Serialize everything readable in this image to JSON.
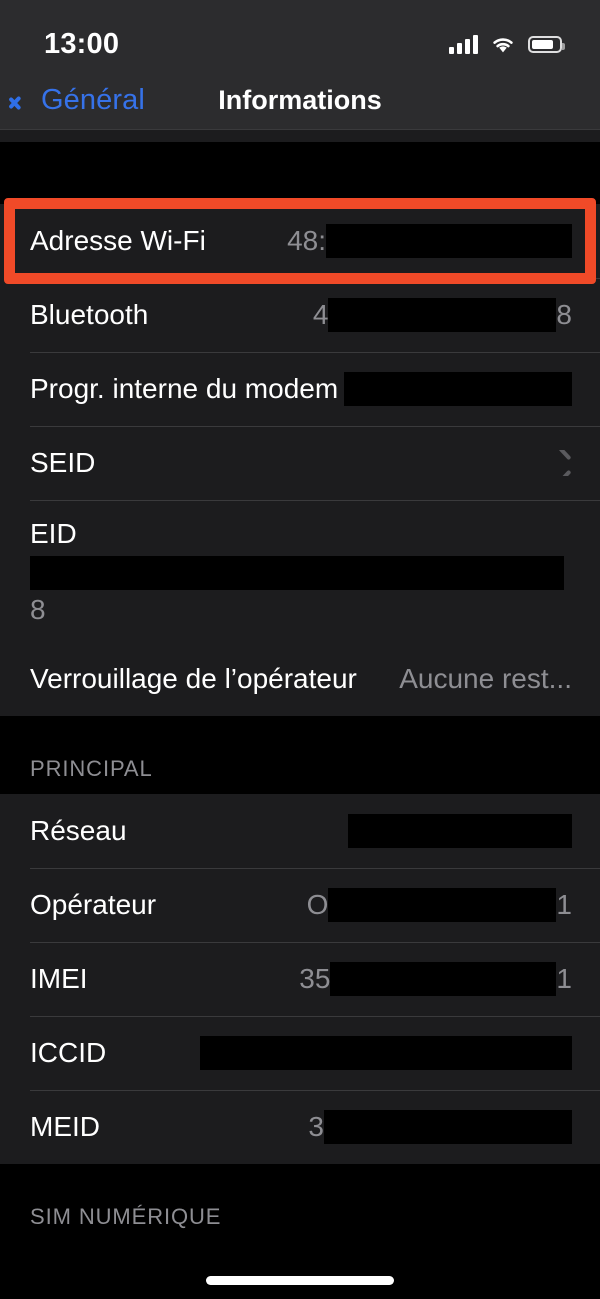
{
  "status_bar": {
    "time": "13:00",
    "icons": [
      "cellular-signal-icon",
      "wifi-icon",
      "battery-icon"
    ]
  },
  "nav": {
    "back_label": "Général",
    "title": "Informations",
    "back_icon": "chevron-left-icon",
    "accent_color": "#3672E9"
  },
  "highlight": {
    "color": "#F04A28",
    "target": "Adresse Wi-Fi"
  },
  "sections": [
    {
      "header": "",
      "rows": [
        {
          "label": "Adresse Wi-Fi",
          "value_prefix": "48:",
          "value_suffix": "",
          "redacted": true,
          "redact_width": 246,
          "type": "value",
          "highlighted": true
        },
        {
          "label": "Bluetooth",
          "value_prefix": "4",
          "value_suffix": "8",
          "redacted": true,
          "redact_width": 228,
          "type": "value"
        },
        {
          "label": "Progr. interne du modem",
          "value_prefix": "",
          "value_suffix": "",
          "redacted": true,
          "redact_width": 228,
          "type": "value"
        },
        {
          "label": "SEID",
          "value_prefix": "",
          "value_suffix": "",
          "redacted": false,
          "type": "disclosure",
          "accessory": "chevron-right-icon"
        },
        {
          "label": "EID",
          "value_prefix": "",
          "value_suffix": "8",
          "redacted": true,
          "redact_width": 548,
          "type": "stacked"
        },
        {
          "label": "Verrouillage de l’opérateur",
          "value_prefix": "Aucune rest...",
          "value_suffix": "",
          "redacted": false,
          "type": "value"
        }
      ]
    },
    {
      "header": "PRINCIPAL",
      "rows": [
        {
          "label": "Réseau",
          "value_prefix": "",
          "value_suffix": "",
          "redacted": true,
          "redact_width": 224,
          "type": "value"
        },
        {
          "label": "Opérateur",
          "value_prefix": "O",
          "value_suffix": "1",
          "redacted": true,
          "redact_width": 228,
          "type": "value"
        },
        {
          "label": "IMEI",
          "value_prefix": "35",
          "value_suffix": "1",
          "redacted": true,
          "redact_width": 226,
          "type": "value"
        },
        {
          "label": "ICCID",
          "value_prefix": "",
          "value_suffix": "",
          "redacted": true,
          "redact_width": 372,
          "type": "value"
        },
        {
          "label": "MEID",
          "value_prefix": "3",
          "value_suffix": "",
          "redacted": true,
          "redact_width": 248,
          "type": "value"
        }
      ]
    },
    {
      "header": "SIM NUMÉRIQUE",
      "rows": []
    }
  ]
}
